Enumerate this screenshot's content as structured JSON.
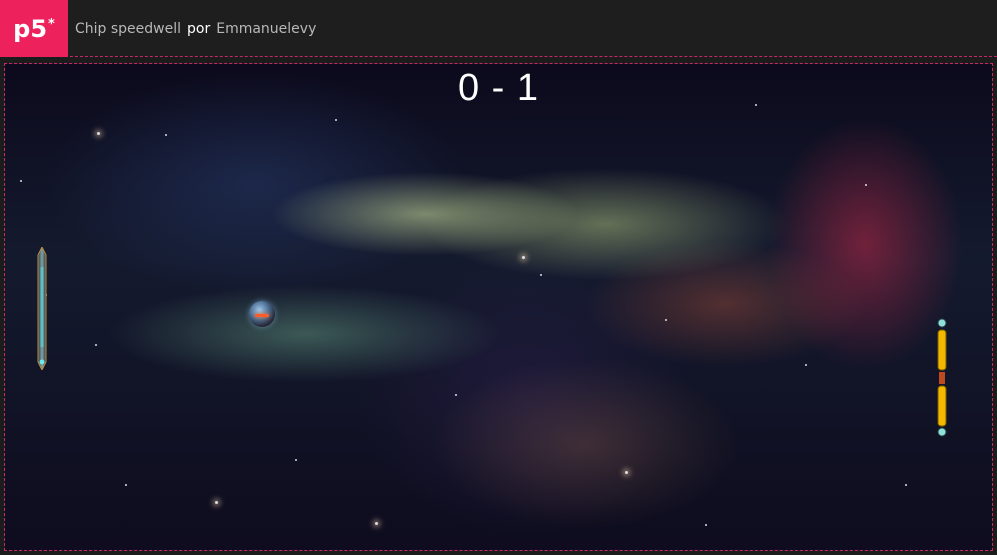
{
  "header": {
    "logo_label": "p5",
    "logo_sup": "*",
    "sketch_name": "Chip speedwell",
    "por": "por",
    "author": "Emmanuelevy"
  },
  "game": {
    "score": "0 - 1"
  },
  "colors": {
    "accent": "#ed225d",
    "border": "#c4286a",
    "header_bg": "#1e1e1e"
  }
}
